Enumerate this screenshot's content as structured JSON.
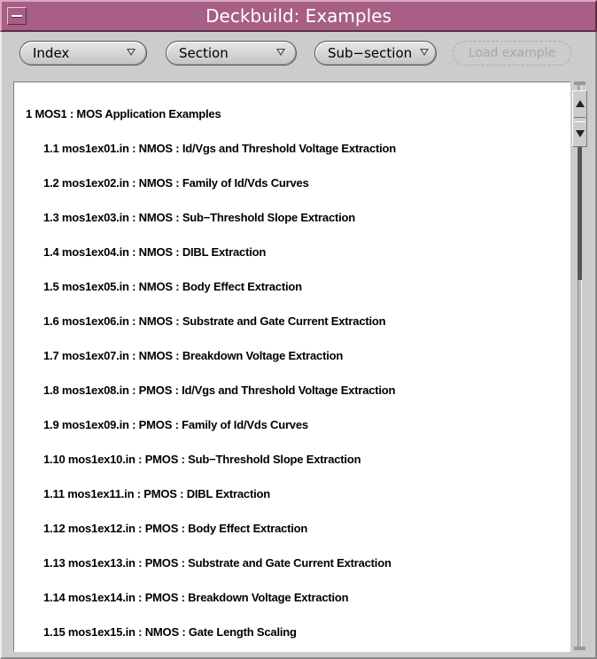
{
  "window": {
    "title": "Deckbuild: Examples"
  },
  "toolbar": {
    "index_label": "Index",
    "section_label": "Section",
    "subsection_label": "Sub−section",
    "load_example_label": "Load example"
  },
  "examples": {
    "heading": "1 MOS1 : MOS Application Examples",
    "items": [
      "1.1 mos1ex01.in : NMOS : Id/Vgs and Threshold Voltage Extraction",
      "1.2 mos1ex02.in : NMOS : Family of Id/Vds Curves",
      "1.3 mos1ex03.in : NMOS : Sub−Threshold Slope Extraction",
      "1.4 mos1ex04.in : NMOS : DIBL Extraction",
      "1.5 mos1ex05.in : NMOS : Body Effect Extraction",
      "1.6 mos1ex06.in : NMOS : Substrate and Gate Current Extraction",
      "1.7 mos1ex07.in : NMOS : Breakdown Voltage Extraction",
      "1.8 mos1ex08.in : PMOS : Id/Vgs and Threshold Voltage Extraction",
      "1.9 mos1ex09.in : PMOS : Family of Id/Vds Curves",
      "1.10 mos1ex10.in : PMOS : Sub−Threshold Slope Extraction",
      "1.11 mos1ex11.in : PMOS : DIBL Extraction",
      "1.12 mos1ex12.in : PMOS : Body Effect Extraction",
      "1.13 mos1ex13.in : PMOS : Substrate and Gate Current Extraction",
      "1.14 mos1ex14.in : PMOS : Breakdown Voltage Extraction",
      "1.15 mos1ex15.in : NMOS : Gate Length Scaling"
    ]
  },
  "icons": {
    "window_menu": "window-menu-icon",
    "dropdown": "triangle-down-icon",
    "scroll_up": "arrow-up-icon",
    "scroll_down": "arrow-down-icon"
  },
  "colors": {
    "titlebar": "#a75f85",
    "panel": "#cccccc",
    "text_pane": "#ffffff"
  }
}
